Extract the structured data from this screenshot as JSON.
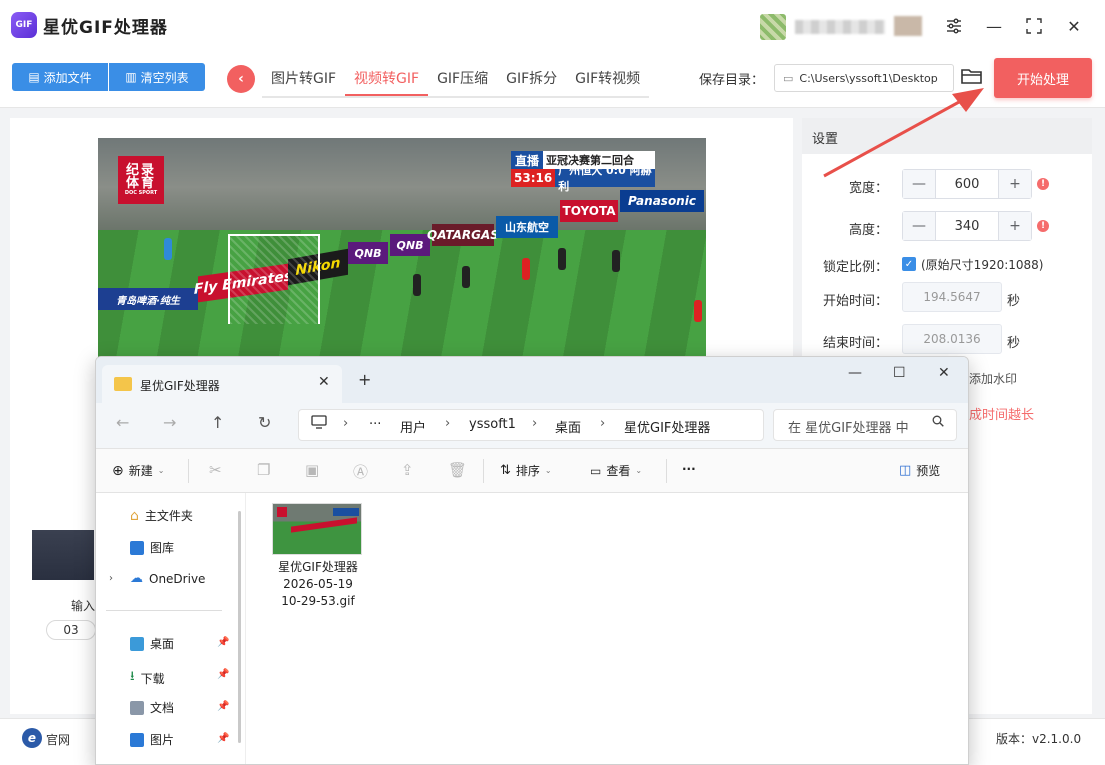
{
  "app": {
    "logo_text": "GIF",
    "title": "星优GIF处理器",
    "window_controls": {
      "settings": "⚙",
      "minimize": "—",
      "maximize": "⛶",
      "close": "✕"
    }
  },
  "toolbar": {
    "add_file": "添加文件",
    "clear_list": "清空列表",
    "tabs": [
      {
        "label": "图片转GIF",
        "active": false
      },
      {
        "label": "视频转GIF",
        "active": true
      },
      {
        "label": "GIF压缩",
        "active": false
      },
      {
        "label": "GIF拆分",
        "active": false
      },
      {
        "label": "GIF转视频",
        "active": false
      }
    ],
    "save_label": "保存目录：",
    "save_path": "C:\\Users\\yssoft1\\Desktop",
    "start_button": "开始处理"
  },
  "preview": {
    "channel_logo_line1": "纪录",
    "channel_logo_line2": "体育",
    "channel_logo_sub": "DOC SPORT",
    "score_live": "直播",
    "score_title": "亚冠决赛第二回合",
    "score_time": "53:16",
    "score_teams": "广州恒大 0:0 阿赫利",
    "ads": [
      "Fly Emirates",
      "Nikon",
      "QNB",
      "QNB",
      "QATARGAS",
      "山东航空",
      "TOYOTA",
      "Panasonic",
      "青岛啤酒·纯生"
    ]
  },
  "file_list": {
    "input_label": "输入",
    "pill_value": "03"
  },
  "settings": {
    "header": "设置",
    "width_label": "宽度：",
    "width_value": "600",
    "height_label": "高度：",
    "height_value": "340",
    "lock_label": "锁定比例：",
    "lock_checked": true,
    "original_size": "(原始尺寸1920:1088)",
    "start_label": "开始时间：",
    "start_value": "194.5647",
    "end_label": "结束时间：",
    "end_value": "208.0136",
    "sec_unit": "秒",
    "watermark_partial": "添加水印",
    "warning_partial": "成时间越长"
  },
  "statusbar": {
    "site_icon": "e",
    "site_label": "官网",
    "version": "版本：v2.1.0.0"
  },
  "explorer": {
    "tab_title": "星优GIF处理器",
    "tab_close": "✕",
    "new_tab": "+",
    "window_controls": {
      "minimize": "—",
      "maximize": "☐",
      "close": "✕"
    },
    "breadcrumb": [
      "用户",
      "yssoft1",
      "桌面",
      "星优GIF处理器"
    ],
    "ellipsis": "···",
    "search_placeholder": "在 星优GIF处理器 中",
    "commands": {
      "new": "新建",
      "sort": "排序",
      "view": "查看",
      "more": "···",
      "preview": "预览"
    },
    "nav": [
      {
        "label": "主文件夹",
        "pinned": false
      },
      {
        "label": "图库",
        "pinned": false
      },
      {
        "label": "OneDrive",
        "pinned": false
      },
      {
        "label": "桌面",
        "pinned": true
      },
      {
        "label": "下载",
        "pinned": true
      },
      {
        "label": "文档",
        "pinned": true
      },
      {
        "label": "图片",
        "pinned": true
      }
    ],
    "file": {
      "line1": "星优GIF处理器",
      "line2": "2026-05-19",
      "line3": "10-29-53.gif"
    }
  },
  "colors": {
    "accent_red": "#f26060",
    "accent_blue": "#3a8ee6",
    "warning": "#f56c6c"
  }
}
